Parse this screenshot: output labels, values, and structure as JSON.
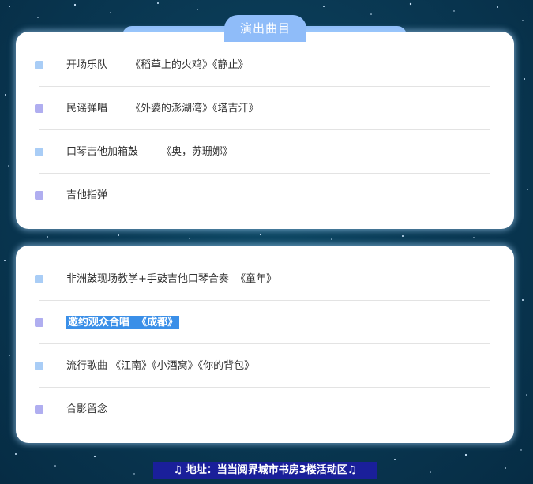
{
  "header": {
    "title": "演出曲目"
  },
  "card1": {
    "rows": [
      {
        "label": "开场乐队",
        "songs": "《稻草上的火鸡》《静止》"
      },
      {
        "label": "民谣弹唱",
        "songs": "《外婆的澎湖湾》《塔吉汗》"
      },
      {
        "label": "口琴吉他加箱鼓",
        "songs": "《奥，苏珊娜》"
      },
      {
        "label": "吉他指弹",
        "songs": ""
      }
    ]
  },
  "card2": {
    "rows": [
      {
        "label": "非洲鼓现场教学+手鼓吉他口琴合奏",
        "songs": "《童年》"
      },
      {
        "label": "邀约观众合唱",
        "songs": "《成都》"
      },
      {
        "label": "流行歌曲",
        "songs": "《江南》《小酒窝》《你的背包》"
      },
      {
        "label": "合影留念",
        "songs": ""
      }
    ]
  },
  "footer": {
    "address": "♫ 地址：当当阅界城市书房3楼活动区♫"
  },
  "colors": {
    "accent": "#8fbcf9",
    "bullet_blue": "#a9cdf6",
    "bullet_purple": "#b0aef0",
    "highlight": "#3a8fe8",
    "address_bg": "#1a1f9a"
  }
}
